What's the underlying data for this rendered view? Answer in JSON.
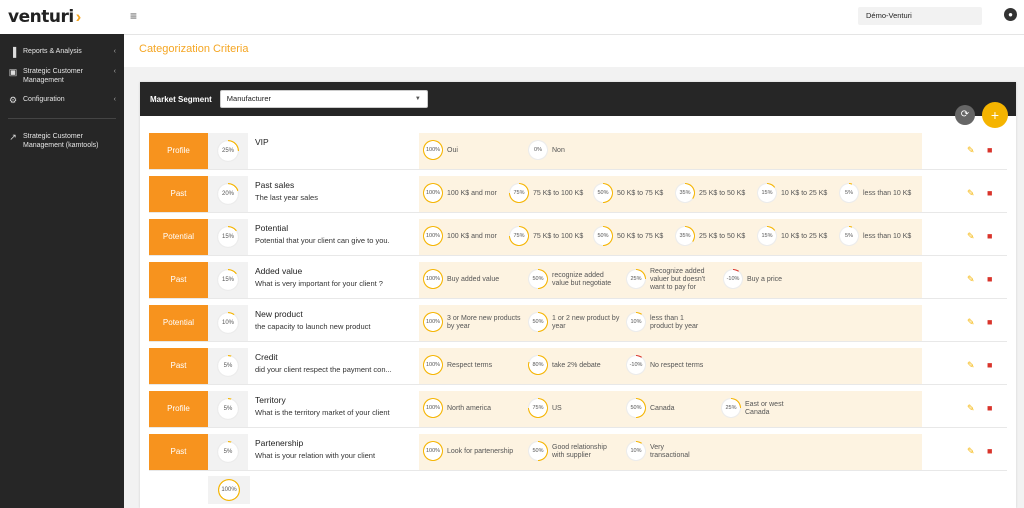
{
  "app": {
    "logo": "venturi",
    "logo_mark": "›"
  },
  "sidebar": {
    "items": [
      {
        "label": "Reports & Analysis",
        "icon": "bar-chart-icon",
        "glyph": "▐"
      },
      {
        "label": "Strategic Customer Management",
        "icon": "briefcase-icon",
        "glyph": "▣"
      },
      {
        "label": "Configuration",
        "icon": "gear-icon",
        "glyph": "⚙"
      }
    ],
    "link": {
      "label": "Strategic Customer Management (kamtools)",
      "icon": "external-link-icon",
      "glyph": "↗"
    }
  },
  "topbar": {
    "company": "Démo-Venturi"
  },
  "page": {
    "title": "Categorization Criteria"
  },
  "segment": {
    "label": "Market Segment",
    "value": "Manufacturer"
  },
  "colors": {
    "accent": "#f7931e",
    "ring": "#f5b400",
    "negative": "#d9342b",
    "sidebar": "#262626"
  },
  "criteria": [
    {
      "tag": "Profile",
      "weight": "25%",
      "weight_value": 25,
      "name": "VIP",
      "desc": "",
      "options": [
        {
          "pct": "100%",
          "value": 100,
          "label": "Oui"
        },
        {
          "pct": "0%",
          "value": 0,
          "label": "Non"
        }
      ]
    },
    {
      "tag": "Past",
      "weight": "20%",
      "weight_value": 20,
      "name": "Past sales",
      "desc": "The last year sales",
      "options": [
        {
          "pct": "100%",
          "value": 100,
          "label": "100 K$ and mor"
        },
        {
          "pct": "75%",
          "value": 75,
          "label": "75 K$ to 100 K$"
        },
        {
          "pct": "50%",
          "value": 50,
          "label": "50 K$ to 75 K$"
        },
        {
          "pct": "35%",
          "value": 35,
          "label": "25 K$ to 50 K$"
        },
        {
          "pct": "15%",
          "value": 15,
          "label": "10 K$ to 25 K$"
        },
        {
          "pct": "5%",
          "value": 5,
          "label": "less than 10 K$"
        }
      ]
    },
    {
      "tag": "Potential",
      "weight": "15%",
      "weight_value": 15,
      "name": "Potential",
      "desc": "Potential that your client can give to you.",
      "options": [
        {
          "pct": "100%",
          "value": 100,
          "label": "100 K$ and mor"
        },
        {
          "pct": "75%",
          "value": 75,
          "label": "75 K$ to 100 K$"
        },
        {
          "pct": "50%",
          "value": 50,
          "label": "50 K$ to 75 K$"
        },
        {
          "pct": "35%",
          "value": 35,
          "label": "25 K$ to 50 K$"
        },
        {
          "pct": "15%",
          "value": 15,
          "label": "10 K$ to 25 K$"
        },
        {
          "pct": "5%",
          "value": 5,
          "label": "less than 10 K$"
        }
      ]
    },
    {
      "tag": "Past",
      "weight": "15%",
      "weight_value": 15,
      "name": "Added value",
      "desc": "What is very important for your client ?",
      "options": [
        {
          "pct": "100%",
          "value": 100,
          "label": "Buy added value"
        },
        {
          "pct": "50%",
          "value": 50,
          "label": "recognize added value but negotiate"
        },
        {
          "pct": "25%",
          "value": 25,
          "label": "Recognize added valuer but doesn't want to pay for"
        },
        {
          "pct": "-10%",
          "value": -10,
          "label": "Buy a price"
        }
      ]
    },
    {
      "tag": "Potential",
      "weight": "10%",
      "weight_value": 10,
      "name": "New product",
      "desc": "the capacity to launch new product",
      "options": [
        {
          "pct": "100%",
          "value": 100,
          "label": "3 or More new products by year"
        },
        {
          "pct": "50%",
          "value": 50,
          "label": "1 or 2 new product by year"
        },
        {
          "pct": "10%",
          "value": 10,
          "label": "less than 1 product by year"
        }
      ]
    },
    {
      "tag": "Past",
      "weight": "5%",
      "weight_value": 5,
      "name": "Credit",
      "desc": "did your client respect the payment con...",
      "options": [
        {
          "pct": "100%",
          "value": 100,
          "label": "Respect terms"
        },
        {
          "pct": "80%",
          "value": 80,
          "label": "take 2% debate"
        },
        {
          "pct": "-10%",
          "value": -10,
          "label": "No respect terms"
        }
      ]
    },
    {
      "tag": "Profile",
      "weight": "5%",
      "weight_value": 5,
      "name": "Territory",
      "desc": "What is the territory market of your client",
      "options": [
        {
          "pct": "100%",
          "value": 100,
          "label": "North america"
        },
        {
          "pct": "75%",
          "value": 75,
          "label": "US"
        },
        {
          "pct": "50%",
          "value": 50,
          "label": "Canada"
        },
        {
          "pct": "25%",
          "value": 25,
          "label": "East or west Canada"
        }
      ]
    },
    {
      "tag": "Past",
      "weight": "5%",
      "weight_value": 5,
      "name": "Partenership",
      "desc": "What is your relation with your client",
      "options": [
        {
          "pct": "100%",
          "value": 100,
          "label": "Look for partenership"
        },
        {
          "pct": "50%",
          "value": 50,
          "label": "Good relationship with supplier"
        },
        {
          "pct": "10%",
          "value": 10,
          "label": "Very transactional"
        }
      ]
    }
  ],
  "total": {
    "pct": "100%",
    "value": 100
  }
}
